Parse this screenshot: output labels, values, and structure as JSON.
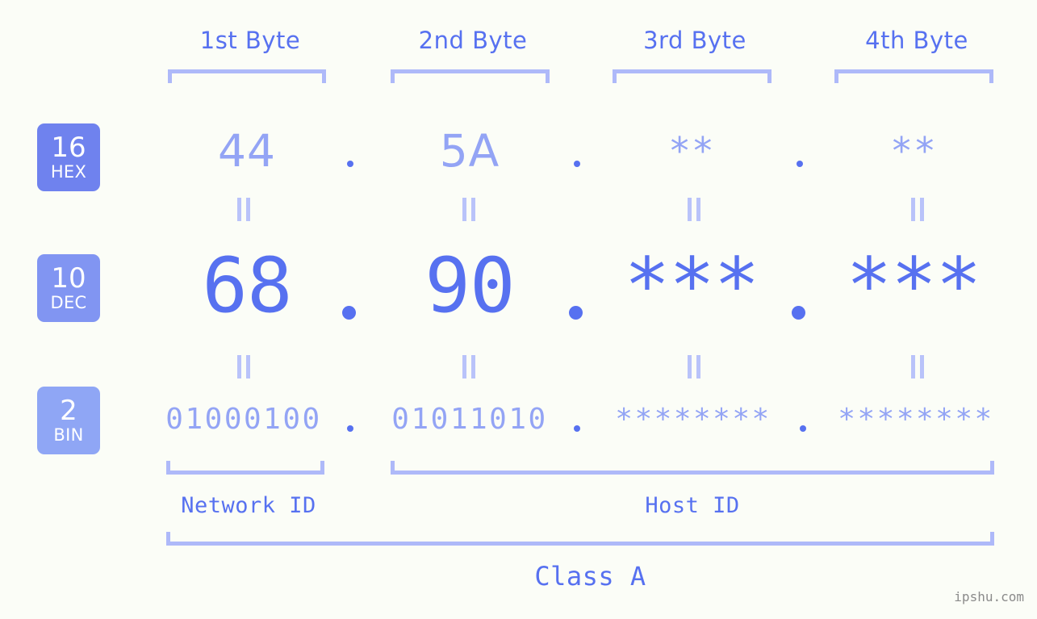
{
  "watermark": "ipshu.com",
  "colors": {
    "background": "#fbfdf7",
    "accent_strong": "#5771f0",
    "accent_mid": "#93a4f5",
    "accent_light": "#aeb9f9",
    "badge_hex": "#6f82ee",
    "badge_dec": "#8195f2",
    "badge_bin": "#8fa6f5"
  },
  "byte_headers": [
    {
      "label": "1st Byte"
    },
    {
      "label": "2nd Byte"
    },
    {
      "label": "3rd Byte"
    },
    {
      "label": "4th Byte"
    }
  ],
  "radix_badges": [
    {
      "number": "16",
      "unit": "HEX"
    },
    {
      "number": "10",
      "unit": "DEC"
    },
    {
      "number": "2",
      "unit": "BIN"
    }
  ],
  "rows": {
    "hex": {
      "label": "HEX",
      "values": [
        "44",
        "5A",
        "**",
        "**"
      ],
      "separators": [
        ".",
        ".",
        "."
      ]
    },
    "dec": {
      "label": "DEC",
      "values": [
        "68",
        "90",
        "***",
        "***"
      ],
      "separators": [
        ".",
        ".",
        "."
      ]
    },
    "bin": {
      "label": "BIN",
      "values": [
        "01000100",
        "01011010",
        "********",
        "********"
      ],
      "separators": [
        ".",
        ".",
        "."
      ]
    }
  },
  "equals_symbol": "||",
  "sections": {
    "network_id": "Network ID",
    "host_id": "Host ID",
    "class": "Class A"
  }
}
